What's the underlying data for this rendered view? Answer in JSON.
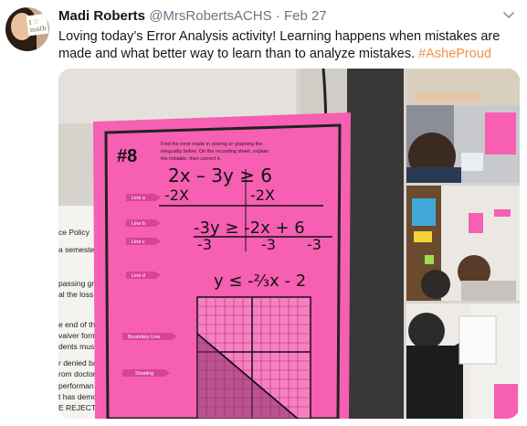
{
  "tweet": {
    "author_name": "Madi Roberts",
    "handle": "@MrsRobertsACHS",
    "separator": "·",
    "date": "Feb 27",
    "text": "Loving today’s Error Analysis activity! Learning happens when mistakes are made and what better way to learn than to analyze mistakes. ",
    "hashtag": "#AsheProud"
  },
  "avatar": {
    "paper_text": "I ♡ math"
  },
  "worksheet": {
    "number": "#8",
    "instructions": "Find the error made in solving or graphing the inequality below. On the recording sheet, explain the mistake, then correct it.",
    "line_labels": [
      "Line a",
      "Line b",
      "Line c",
      "Line d",
      "Boundary Line",
      "Shading"
    ]
  },
  "background_poster": {
    "lines": [
      "ce Policy",
      "a semeste",
      "passing gra",
      "al the loss c",
      "e end of th",
      "vaiver form",
      "dents must",
      "r denied bas",
      "rom doctors",
      "performan",
      "t has demon",
      "E REJECTED"
    ]
  },
  "colors": {
    "hashtag": "#f0914a",
    "worksheet_pink": "#f65fb2",
    "text_secondary": "#657786"
  },
  "icons": [
    "chevron-down-icon"
  ]
}
